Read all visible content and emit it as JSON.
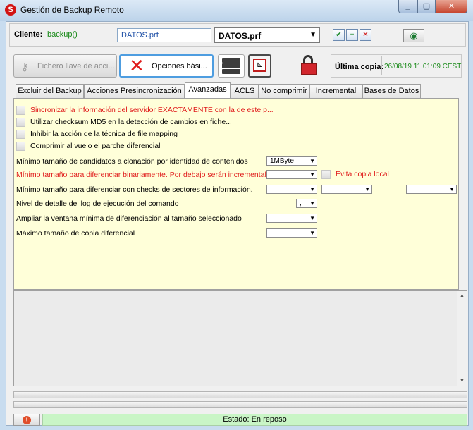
{
  "window": {
    "title": "Gestión de Backup Remoto"
  },
  "client": {
    "label": "Cliente:",
    "value": "backup()",
    "file_field": "DATOS.prf",
    "profile_select": "DATOS.prf"
  },
  "toolbar": {
    "key_file_label": "Fichero llave de acci...",
    "options_label": "Opciones bási...",
    "last_copy_label": "Última copia:",
    "last_copy_value": "26/08/19 11:01:09 CEST"
  },
  "tabs": [
    "Excluir del Backup",
    "Acciones Presincronización",
    "Avanzadas",
    "ACLS",
    "No comprimir",
    "Incremental",
    "Bases de Datos"
  ],
  "active_tab": "Avanzadas",
  "checks": [
    {
      "label": "Sincronizar la información del servidor EXACTAMENTE con la de este p...",
      "color": "#e01b1b"
    },
    {
      "label": "Utilizar checksum MD5 en la detección de cambios en fiche...",
      "color": "#000000"
    },
    {
      "label": "Inhibir la acción de la técnica de file mapping",
      "color": "#000000"
    },
    {
      "label": "Comprimir al vuelo el parche diferencial",
      "color": "#000000"
    }
  ],
  "options": {
    "min_clone": {
      "label": "Mínimo tamaño de candidatos a clonación por identidad de contenidos",
      "value": "1MByte"
    },
    "min_binary": {
      "label": "Mínimo tamaño para diferenciar binariamente. Por debajo serán incrementales.",
      "value": "",
      "extra_check": "Evita copia local"
    },
    "min_sectors": {
      "label": "Mínimo tamaño para diferenciar con checks de sectores de información.",
      "value": ""
    },
    "log_level": {
      "label": "Nivel de detalle del log de ejecución del comando",
      "value": ","
    },
    "min_window": {
      "label": "Ampliar la ventana mínima de diferenciación al tamaño seleccionado",
      "value": ""
    },
    "max_diff": {
      "label": "Máximo tamaño de copia diferencial",
      "value": ""
    }
  },
  "status": {
    "text": "Estado: En reposo"
  },
  "colors": {
    "status_bg": "#c9f5c6",
    "panel_bg": "#ffffd9",
    "client_value": "#1a8a1a"
  }
}
